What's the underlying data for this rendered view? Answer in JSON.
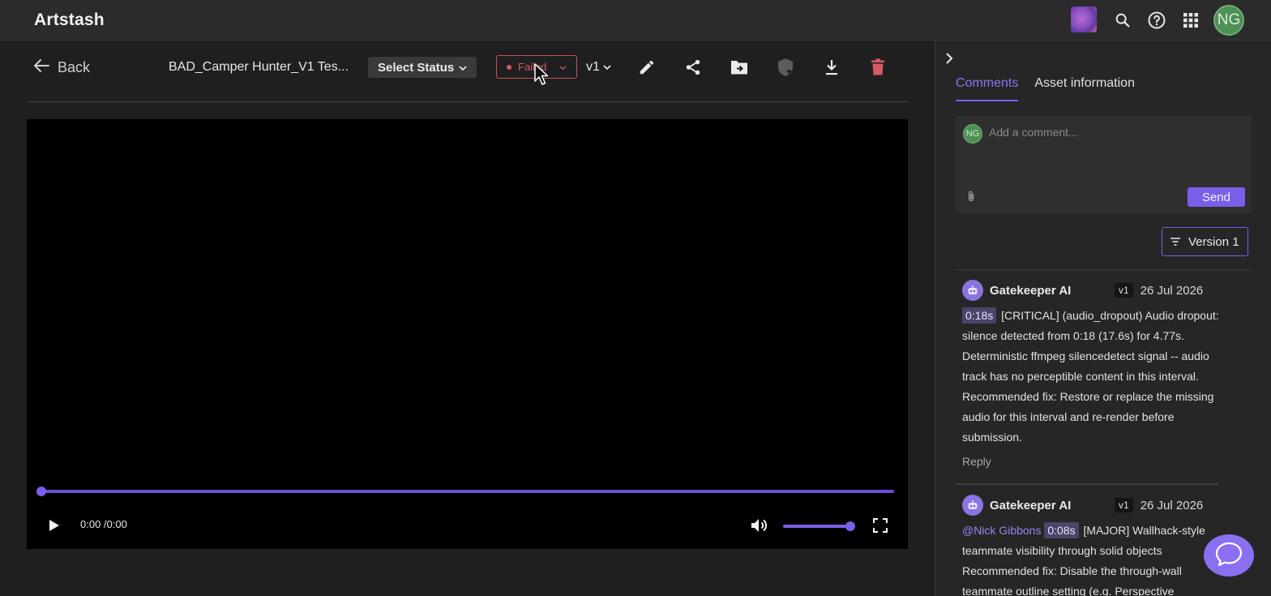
{
  "app": {
    "name": "Artstash"
  },
  "header": {
    "user_initials": "NG"
  },
  "toolbar": {
    "back_label": "Back",
    "asset_title": "BAD_Camper Hunter_V1 Tes...",
    "status_select_label": "Select Status",
    "qc_status": "Failed",
    "version": "v1"
  },
  "player": {
    "timecode": "0:00 /0:00",
    "progress": 0.0,
    "volume": 1.0
  },
  "panel": {
    "tabs": [
      "Comments",
      "Asset information"
    ],
    "active_tab": "Comments",
    "comment_input": {
      "avatar_initials": "NG",
      "placeholder": "Add a comment...",
      "send_label": "Send"
    },
    "filter_label": "Version 1",
    "comments": [
      {
        "author": "Gatekeeper AI",
        "version": "v1",
        "date": "26 Jul 2026",
        "timestamp": "0:18s",
        "mention": "",
        "text": "[CRITICAL] (audio_dropout) Audio dropout: silence detected from 0:18 (17.6s) for 4.77s. Deterministic ffmpeg silencedetect signal -- audio track has no perceptible content in this interval. Recommended fix: Restore or replace the missing audio for this interval and re-render before submission.",
        "reply_label": "Reply"
      },
      {
        "author": "Gatekeeper AI",
        "version": "v1",
        "date": "26 Jul 2026",
        "timestamp": "0:08s",
        "mention": "@Nick Gibbons",
        "text": "[MAJOR] Wallhack-style teammate visibility through solid objects Recommended fix: Disable the through-wall teammate outline setting (e.g. Perspective",
        "reply_label": "Reply"
      }
    ]
  },
  "colors": {
    "accent": "#7b5ee8",
    "failed": "#d45a66",
    "avatar_green": "#4e8f55"
  },
  "icons": [
    "org-logo-icon",
    "search-icon",
    "help-icon",
    "apps-grid-icon",
    "arrow-left-icon",
    "chevron-down-icon",
    "edit-pencil-icon",
    "share-icon",
    "move-to-folder-icon",
    "shield-add-icon",
    "download-icon",
    "trash-icon",
    "play-icon",
    "volume-icon",
    "fullscreen-icon",
    "chevron-right-icon",
    "attachment-icon",
    "filter-icon",
    "robot-avatar-icon",
    "chat-bubble-icon"
  ]
}
